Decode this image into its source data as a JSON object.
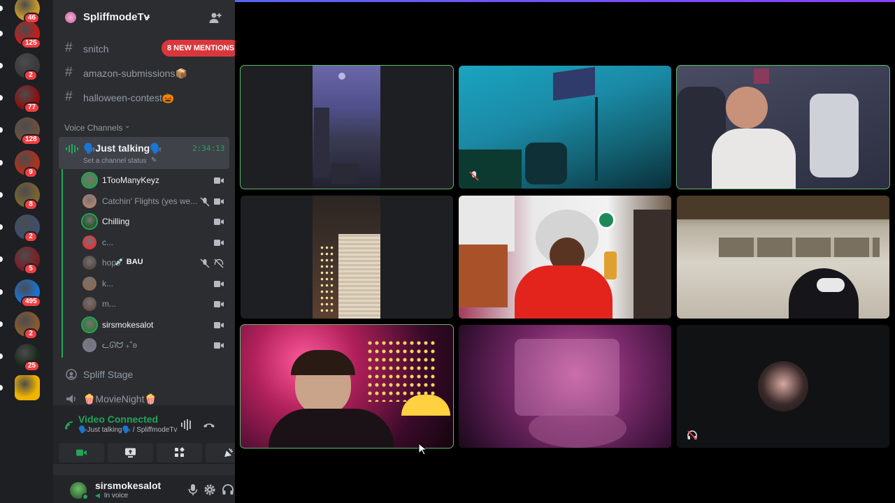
{
  "rail": {
    "servers": [
      {
        "icon": "server-spliff-icon",
        "color": "#c89a2b",
        "badge": "46"
      },
      {
        "icon": "server-vr-icon",
        "color": "#c21d1d",
        "badge": "125"
      },
      {
        "icon": "server-mic-icon",
        "color": "#3a3a3a",
        "badge": "2"
      },
      {
        "icon": "server-red-icon",
        "color": "#8a1010",
        "badge": "77"
      },
      {
        "icon": "server-face-icon",
        "color": "#6b5040",
        "badge": "128"
      },
      {
        "icon": "server-mario-icon",
        "color": "#b0301c",
        "badge": "9"
      },
      {
        "icon": "server-pot-icon",
        "color": "#7a6430",
        "badge": "8"
      },
      {
        "icon": "server-cartoon-icon",
        "color": "#3c4f6b",
        "badge": "2"
      },
      {
        "icon": "server-skull-icon",
        "color": "#7a1f24",
        "badge": "5"
      },
      {
        "icon": "server-blue-icon",
        "color": "#1a72d0",
        "badge": "495"
      },
      {
        "icon": "server-people-icon",
        "color": "#8a5a30",
        "badge": "2"
      },
      {
        "icon": "server-leaf-icon",
        "color": "#1a2a1a",
        "badge": "25"
      },
      {
        "icon": "server-yellow-icon",
        "color": "#f0b400",
        "badge": ""
      }
    ]
  },
  "server": {
    "name": "SpliffmodeTv",
    "chevron": "⌄"
  },
  "text_channels": [
    {
      "name": "snitch",
      "mentions": "8 NEW MENTIONS"
    },
    {
      "name": "amazon-submissions📦"
    },
    {
      "name": "halloween-contest🎃"
    }
  ],
  "voice_category": "Voice Channels",
  "active_voice": {
    "name": "🗣️Just talking🗣️",
    "timer": "2:34:13",
    "status": "Set a channel status"
  },
  "voice_users": [
    {
      "name": "1TooManyKeyz",
      "color": "#4a8a4a",
      "highlight": true,
      "icons": [
        "camera"
      ]
    },
    {
      "name": "Catchin' Flights (yes we...",
      "color": "#b08070",
      "highlight": false,
      "icons": [
        "mute",
        "camera"
      ]
    },
    {
      "name": "Chilling",
      "color": "#2a5a2a",
      "highlight": true,
      "icons": [
        "camera"
      ]
    },
    {
      "name": "c...",
      "color": "#da373c",
      "highlight": false,
      "icons": [
        "camera"
      ]
    },
    {
      "name": "hope",
      "tag": "💉 BAU",
      "color": "#5a4a44",
      "highlight": false,
      "icons": [
        "mute",
        "deafen"
      ]
    },
    {
      "name": "k...",
      "color": "#8a6a50",
      "highlight": false,
      "icons": [
        "camera"
      ]
    },
    {
      "name": "m...",
      "color": "#6a5048",
      "highlight": false,
      "icons": [
        "camera"
      ]
    },
    {
      "name": "sirsmokesalot",
      "color": "#3a7a3a",
      "highlight": true,
      "icons": [
        "camera"
      ]
    },
    {
      "name": "ᓚᘏᗢ ₊˚ʚ",
      "color": "#7a7a8a",
      "highlight": false,
      "icons": [
        "camera"
      ]
    }
  ],
  "other_voice_channels": [
    {
      "name": "Spliff Stage",
      "icon": "stage-icon"
    },
    {
      "name": "🍿MovieNight🍿",
      "icon": "speaker-icon"
    }
  ],
  "voice_panel": {
    "title": "Video Connected",
    "subtitle": "🗣️Just talking🗣️ / SpliffmodeTv"
  },
  "user_panel": {
    "name": "sirsmokesalot",
    "status": "In voice"
  },
  "stage": {
    "tiles": [
      {
        "name": "tile-1",
        "speaking": true,
        "scene": "dark-room-portrait"
      },
      {
        "name": "tile-2",
        "speaking": false,
        "scene": "teal-room",
        "muted": true
      },
      {
        "name": "tile-3",
        "speaking": true,
        "scene": "gamer-chair"
      },
      {
        "name": "tile-4",
        "speaking": false,
        "scene": "fairy-lights"
      },
      {
        "name": "tile-5",
        "speaking": false,
        "scene": "red-hoodie"
      },
      {
        "name": "tile-6",
        "speaking": false,
        "scene": "garage"
      },
      {
        "name": "tile-7",
        "speaking": true,
        "scene": "fireworks"
      },
      {
        "name": "tile-8",
        "speaking": false,
        "scene": "pink-lights"
      },
      {
        "name": "tile-9",
        "speaking": false,
        "scene": "avatar-only",
        "deafened": true
      }
    ]
  },
  "colors": {
    "green": "#23a55a",
    "red_badge": "#f23f43",
    "accent": "#5865f2"
  }
}
